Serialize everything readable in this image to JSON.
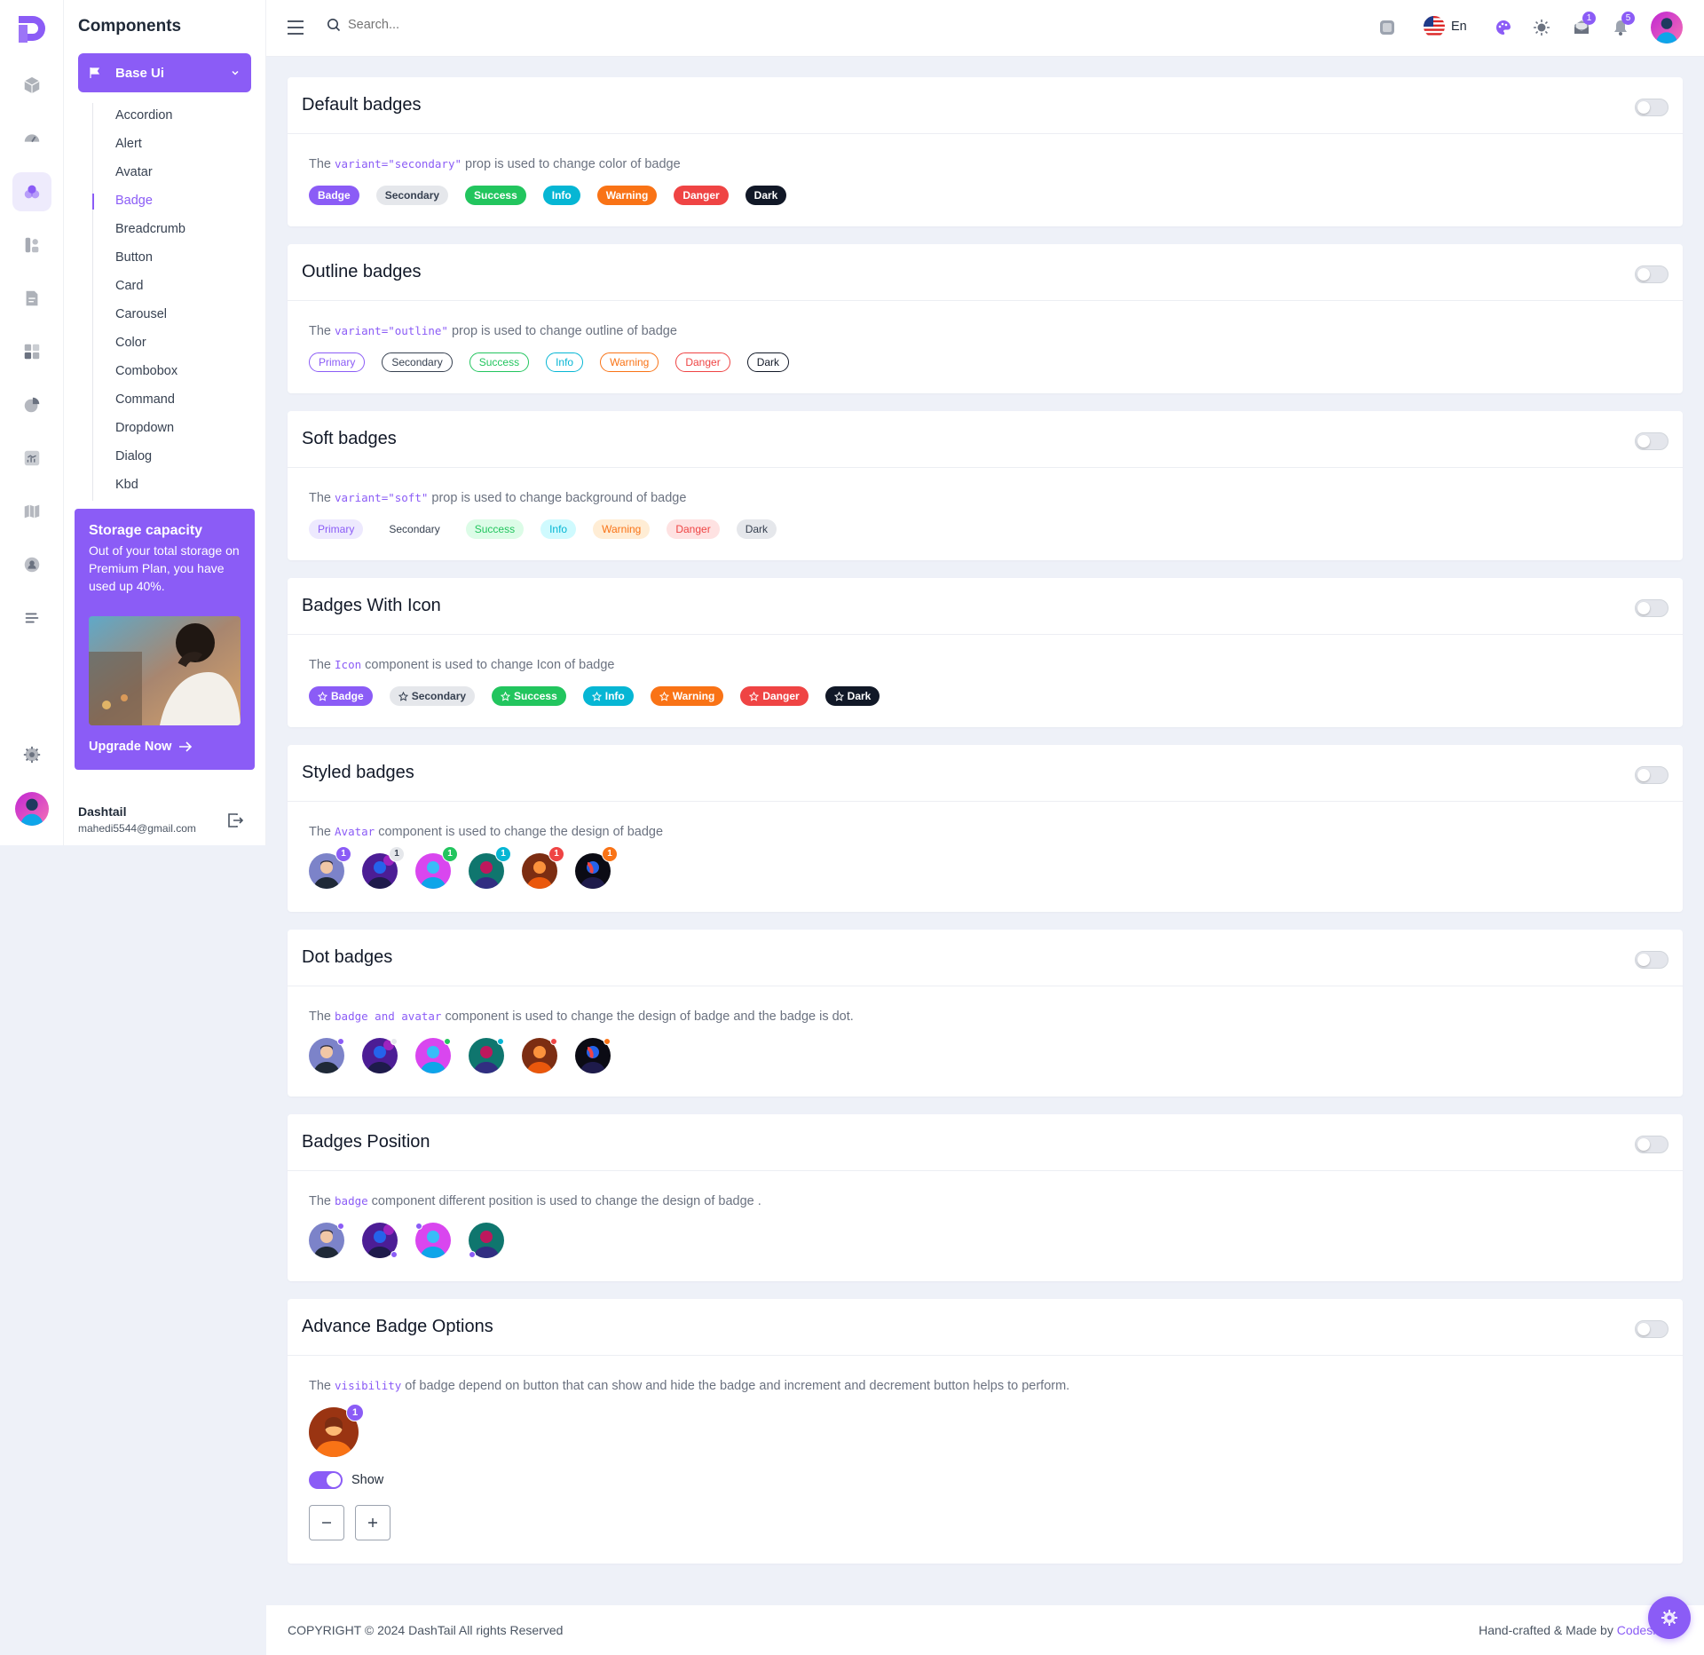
{
  "sidebar": {
    "title": "Components",
    "group_label": "Base Ui",
    "items": [
      "Accordion",
      "Alert",
      "Avatar",
      "Badge",
      "Breadcrumb",
      "Button",
      "Card",
      "Carousel",
      "Color",
      "Combobox",
      "Command",
      "Dropdown",
      "Dialog",
      "Kbd"
    ],
    "active_item": "Badge",
    "storage": {
      "title": "Storage capacity",
      "text": "Out of your total storage on Premium Plan, you have used up 40%.",
      "cta": "Upgrade Now"
    },
    "user": {
      "name": "Dashtail",
      "email": "mahedi5544@gmail.com"
    }
  },
  "rail_icons": [
    "cube-icon",
    "dashboard-gauge-icon",
    "components-icon",
    "apps-icon",
    "document-icon",
    "widgets-icon",
    "pie-chart-icon",
    "bar-chart-icon",
    "map-icon",
    "user-icon",
    "menu-lines-icon",
    "settings-icon"
  ],
  "topbar": {
    "search_placeholder": "Search...",
    "language": "En",
    "mail_count": "1",
    "notification_count": "5"
  },
  "sections": {
    "default": {
      "title": "Default badges",
      "desc_pre": "The ",
      "desc_code": "variant=\"secondary\"",
      "desc_post": " prop is used to change color of badge",
      "badges": [
        "Badge",
        "Secondary",
        "Success",
        "Info",
        "Warning",
        "Danger",
        "Dark"
      ]
    },
    "outline": {
      "title": "Outline badges",
      "desc_pre": "The ",
      "desc_code": "variant=\"outline\"",
      "desc_post": " prop is used to change outline of badge",
      "badges": [
        "Primary",
        "Secondary",
        "Success",
        "Info",
        "Warning",
        "Danger",
        "Dark"
      ]
    },
    "soft": {
      "title": "Soft badges",
      "desc_pre": "The ",
      "desc_code": "variant=\"soft\"",
      "desc_post": " prop is used to change background of badge",
      "badges": [
        "Primary",
        "Secondary",
        "Success",
        "Info",
        "Warning",
        "Danger",
        "Dark"
      ]
    },
    "icon": {
      "title": "Badges With Icon",
      "desc_pre": "The ",
      "desc_code": "Icon",
      "desc_post": " component is used to change Icon of badge",
      "badges": [
        "Badge",
        "Secondary",
        "Success",
        "Info",
        "Warning",
        "Danger",
        "Dark"
      ]
    },
    "styled": {
      "title": "Styled badges",
      "desc_pre": "The ",
      "desc_code": "Avatar",
      "desc_post": " component is used to change the design of badge",
      "counts": [
        "1",
        "1",
        "1",
        "1",
        "1",
        "1"
      ]
    },
    "dot": {
      "title": "Dot badges",
      "desc_pre": "The ",
      "desc_code": "badge and avatar",
      "desc_post": " component is used to change the design of badge and the badge is dot."
    },
    "position": {
      "title": "Badges Position",
      "desc_pre": "The ",
      "desc_code": "badge",
      "desc_post": " component different position is used to change the design of badge ."
    },
    "advance": {
      "title": "Advance Badge Options",
      "desc_pre": "The ",
      "desc_code": "visibility",
      "desc_post": " of badge depend on button that can show and hide the badge and increment and decrement button helps to perform.",
      "count": "1",
      "switch_label": "Show",
      "switch_on": true
    }
  },
  "colors": {
    "primary": "#8b5cf6",
    "secondary_bg": "#e5e7eb",
    "success": "#22c55e",
    "info": "#06b6d4",
    "warning": "#f97316",
    "danger": "#ef4444",
    "dark": "#111827"
  },
  "footer": {
    "copyright": "COPYRIGHT © 2024 DashTail All rights Reserved",
    "made_by_prefix": "Hand-crafted & Made by ",
    "made_by_name": "Codesh"
  }
}
